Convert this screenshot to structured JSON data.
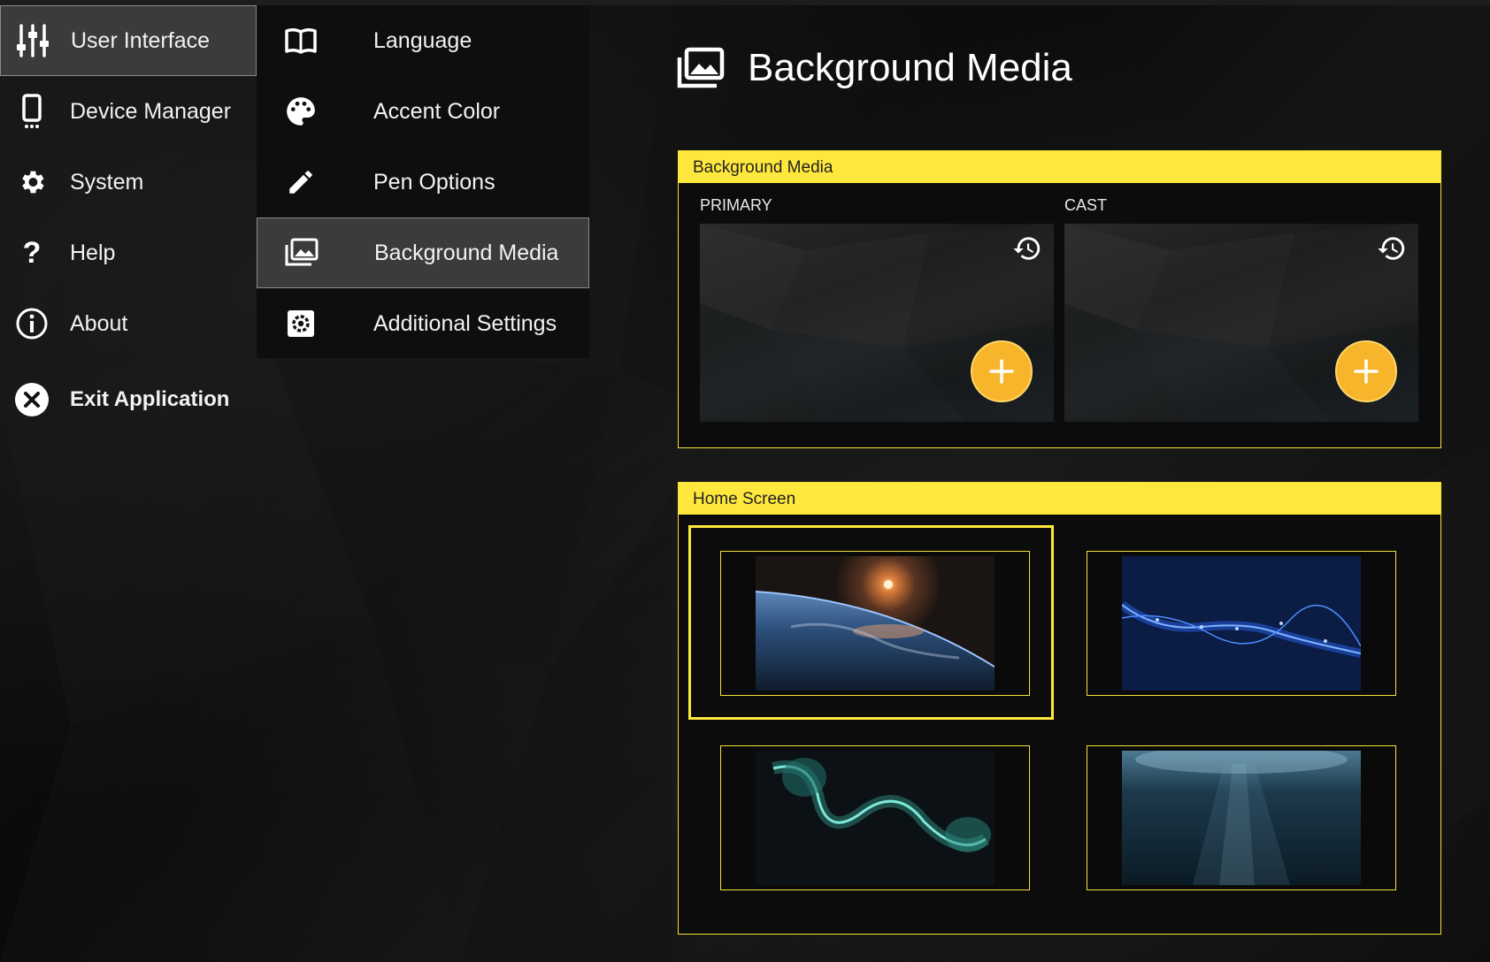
{
  "primary_nav": [
    {
      "label": "User Interface",
      "icon": "sliders-icon",
      "active": true
    },
    {
      "label": "Device Manager",
      "icon": "device-icon",
      "active": false
    },
    {
      "label": "System",
      "icon": "gear-icon",
      "active": false
    },
    {
      "label": "Help",
      "icon": "question-icon",
      "active": false
    },
    {
      "label": "About",
      "icon": "info-icon",
      "active": false
    },
    {
      "label": "Exit Application",
      "icon": "close-circle-icon",
      "active": false
    }
  ],
  "secondary_nav": [
    {
      "label": "Language",
      "icon": "book-icon",
      "active": false
    },
    {
      "label": "Accent Color",
      "icon": "palette-icon",
      "active": false
    },
    {
      "label": "Pen Options",
      "icon": "pen-icon",
      "active": false
    },
    {
      "label": "Background Media",
      "icon": "images-icon",
      "active": true
    },
    {
      "label": "Additional Settings",
      "icon": "settings-box-icon",
      "active": false
    }
  ],
  "page": {
    "title": "Background Media",
    "icon": "images-icon"
  },
  "background_panel": {
    "header": "Background Media",
    "primary_label": "PRIMARY",
    "cast_label": "CAST"
  },
  "home_panel": {
    "header": "Home Screen",
    "selected_index": 0,
    "items": [
      "earth-sunrise-image",
      "blue-network-wave-image",
      "teal-smoke-image",
      "underwater-light-image"
    ]
  },
  "colors": {
    "accent": "#ffe83d",
    "add_button": "#f6b52a",
    "active_nav_bg": "#3b3b3b"
  }
}
